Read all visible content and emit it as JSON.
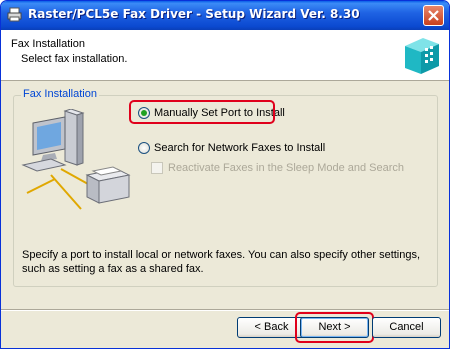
{
  "window": {
    "title": "Raster/PCL5e Fax Driver - Setup Wizard Ver. 8.30"
  },
  "header": {
    "title": "Fax Installation",
    "subtitle": "Select fax installation."
  },
  "group": {
    "legend": "Fax Installation"
  },
  "options": {
    "manual": {
      "label": "Manually Set Port to Install",
      "selected": true
    },
    "search": {
      "label": "Search for Network Faxes to Install",
      "selected": false
    },
    "reactivate": {
      "label": "Reactivate Faxes in the Sleep Mode and Search",
      "checked": false,
      "enabled": false
    }
  },
  "description": "Specify a port to install local or network faxes. You can also specify other settings, such as setting a fax as a shared fax.",
  "buttons": {
    "back": "< Back",
    "next": "Next >",
    "cancel": "Cancel"
  },
  "colors": {
    "highlight": "#e0001b",
    "titlebar": "#0b49d0",
    "legend": "#0046d5"
  }
}
